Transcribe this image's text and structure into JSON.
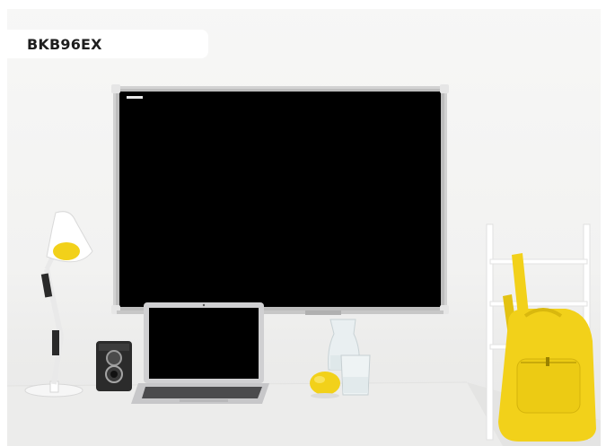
{
  "product": {
    "code_label": "BKB96EX"
  },
  "scene": {
    "board_color": "#000000",
    "frame_color": "#c9c9c9",
    "accent_yellow": "#f2d11a",
    "wall_color": "#f4f4f3",
    "desk_color": "#ededec"
  },
  "icons": {
    "board": "blackboard-icon",
    "laptop": "laptop-icon",
    "lamp": "desk-lamp-icon",
    "camera": "camera-icon",
    "lemon": "lemon-icon",
    "backpack": "backpack-icon",
    "ladder": "ladder-shelf-icon",
    "jug": "glass-jug-icon"
  }
}
